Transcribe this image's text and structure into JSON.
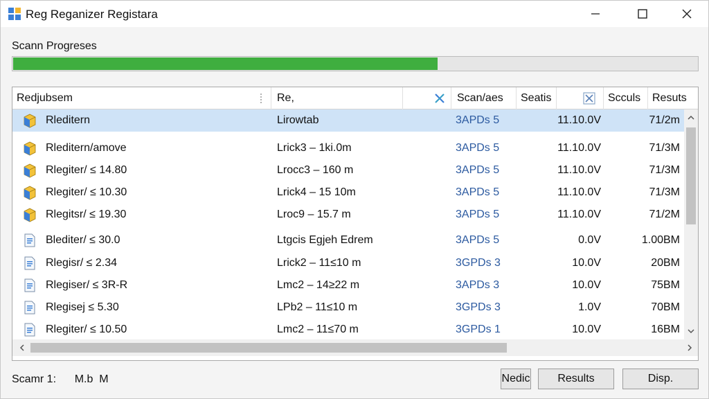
{
  "window": {
    "title": "Reg Reganizer Registara",
    "icons": {
      "app": "windows-registry-icon",
      "minimize": "minimize-icon",
      "maximize": "maximize-icon",
      "close": "close-icon"
    }
  },
  "progress": {
    "label": "Scann Progreses",
    "fraction": 0.62,
    "color": "#3fae3f"
  },
  "table": {
    "headers": {
      "name": "Redjubsem",
      "reg": "Re,",
      "scan": "Scan/aes",
      "seats": "Seatis",
      "sculs": "Scculs",
      "results": "Resuts"
    },
    "rows": [
      {
        "icon": "registry-cube-icon",
        "name": "Rleditern",
        "reg": "Lirowtab",
        "scan": "3APDs 5",
        "seats": "11.10.0V",
        "results": "71/2m",
        "selected": true
      },
      {
        "icon": "registry-cube-icon",
        "name": "Rleditern/amove",
        "reg": "Lrick3 – 1ki.0m",
        "scan": "3APDs 5",
        "seats": "11.10.0V",
        "results": "71/3M",
        "selected": false
      },
      {
        "icon": "registry-cube-icon",
        "name": "Rlegiter/ ≤ 14.80",
        "reg": "Lrocc3 – 160 m",
        "scan": "3APDs 5",
        "seats": "11.10.0V",
        "results": "71/3M",
        "selected": false
      },
      {
        "icon": "registry-cube-icon",
        "name": "Rlegiter/ ≤ 10.30",
        "reg": "Lrick4 – 15 10m",
        "scan": "3APDs 5",
        "seats": "11.10.0V",
        "results": "71/3M",
        "selected": false
      },
      {
        "icon": "registry-cube-icon",
        "name": "Rlegitsr/ ≤ 19.30",
        "reg": "Lroc9 – 15.7 m",
        "scan": "3APDs 5",
        "seats": "11.10.0V",
        "results": "71/2M",
        "selected": false
      },
      {
        "icon": "registry-file-icon",
        "name": "Blediter/ ≤ 30.0",
        "reg": "Ltgcis Egjeh Edrem",
        "scan": "3APDs 5",
        "seats": "0.0V",
        "results": "1.00BM",
        "selected": false
      },
      {
        "icon": "registry-file-icon",
        "name": "Rlegisr/ ≤ 2.34",
        "reg": "Lrick2 – 11≤10 m",
        "scan": "3GPDs 3",
        "seats": "10.0V",
        "results": "20BM",
        "selected": false
      },
      {
        "icon": "registry-file-icon",
        "name": "Rlegiser/ ≤ 3R-R",
        "reg": "Lmc2 – 14≥22 m",
        "scan": "3APDs 3",
        "seats": "10.0V",
        "results": "75BM",
        "selected": false
      },
      {
        "icon": "registry-file-icon",
        "name": "Rlegisej ≤ 5.30",
        "reg": "LPb2 – 11≤10 m",
        "scan": "3GPDs 3",
        "seats": "1.0V",
        "results": "70BM",
        "selected": false
      },
      {
        "icon": "registry-file-icon",
        "name": "Rlegiter/ ≤ 10.50",
        "reg": "Lmc2 – 11≤70 m",
        "scan": "3GPDs 1",
        "seats": "10.0V",
        "results": "16BM",
        "selected": false
      }
    ]
  },
  "status": {
    "text": "Scamr 1:      M.b  M"
  },
  "buttons": {
    "small": "Nedic",
    "results": "Results",
    "disp": "Disp."
  }
}
